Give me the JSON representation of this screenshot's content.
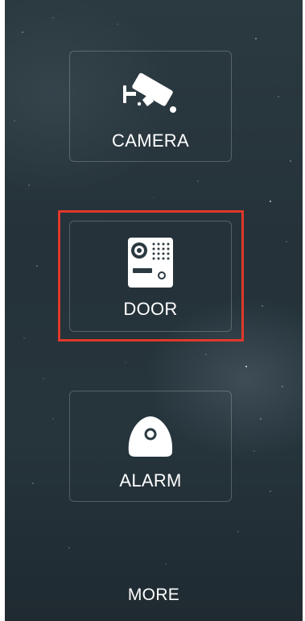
{
  "menu": {
    "items": [
      {
        "label": "CAMERA",
        "icon": "cctv-camera-icon"
      },
      {
        "label": "DOOR",
        "icon": "door-intercom-icon",
        "selected": true
      },
      {
        "label": "ALARM",
        "icon": "alarm-sensor-icon"
      }
    ],
    "more_label": "MORE"
  },
  "colors": {
    "background": "#26343c",
    "text": "#ffffff",
    "tile_border": "rgba(255,255,255,0.22)",
    "highlight": "#e0392b"
  }
}
